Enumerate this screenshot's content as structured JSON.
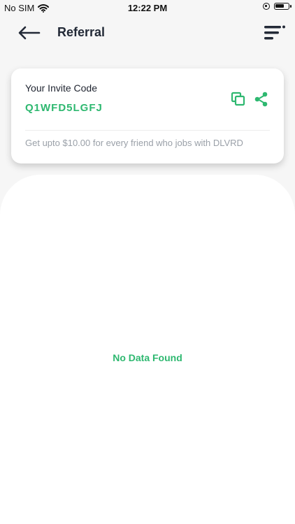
{
  "status_bar": {
    "carrier": "No SIM",
    "time": "12:22 PM"
  },
  "header": {
    "title": "Referral",
    "back_icon": "arrow-left-icon",
    "menu_icon": "menu-icon"
  },
  "invite": {
    "label": "Your Invite Code",
    "code": "Q1WFD5LGFJ",
    "info": "Get upto $10.00 for every friend who jobs with DLVRD",
    "copy_icon": "copy-icon",
    "share_icon": "share-icon"
  },
  "empty": {
    "message": "No Data Found"
  },
  "colors": {
    "accent": "#2eb870",
    "text": "#1f2430",
    "muted": "#9aa0a8",
    "background": "#f6f6f6",
    "card": "#ffffff"
  }
}
